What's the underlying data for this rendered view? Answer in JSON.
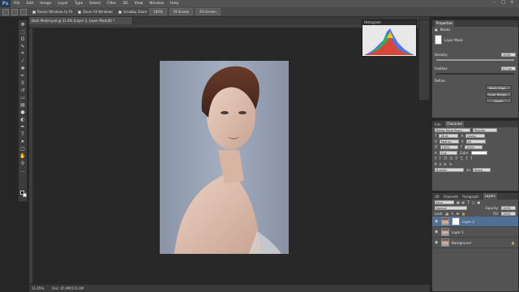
{
  "app": {
    "logo": "Ps"
  },
  "menu": [
    "File",
    "Edit",
    "Image",
    "Layer",
    "Type",
    "Select",
    "Filter",
    "3D",
    "View",
    "Window",
    "Help"
  ],
  "options": {
    "resize_windows": "Resize Windows to Fit",
    "zoom_all": "Zoom All Windows",
    "scrubby_zoom": "Scrubby Zoom",
    "btn_100": "100%",
    "btn_fit": "Fit Screen",
    "btn_fill": "Fill Screen"
  },
  "document": {
    "tab_title": "Dark Model.psd @ 11.6% (Layer 2, Layer Mask/8) *",
    "zoom": "11.65%",
    "doc_size": "Doc: 65.9M/115.4M"
  },
  "histogram": {
    "title": "Histogram"
  },
  "properties": {
    "tab": "Properties",
    "masks_label": "Masks",
    "layer_mask_label": "Layer Mask",
    "density_label": "Density:",
    "density_value": "100%",
    "density_level": 1.0,
    "feather_label": "Feather:",
    "feather_value": "0.0 px",
    "feather_level": 0.0,
    "refine_label": "Refine:",
    "btn_mask_edge": "Mask Edge...",
    "btn_color_range": "Color Range...",
    "btn_invert": "Invert"
  },
  "character": {
    "tabs": [
      "Info",
      "Character"
    ],
    "font": "Bebas Neue Regu...",
    "style": "Regular",
    "size": "28 pt",
    "leading": "(Auto)",
    "kerning": "Metrics",
    "tracking": "40",
    "vscale": "100%",
    "hscale": "100%",
    "baseline": "0 pt",
    "color_label": "Color:",
    "lang": "Russian",
    "aa": "Sharp"
  },
  "layers": {
    "tabs": [
      "3D",
      "Channels",
      "Paragraph",
      "Layers"
    ],
    "kind_filter": "Kind",
    "blend_mode": "Normal",
    "opacity_label": "Opacity:",
    "opacity_value": "100%",
    "lock_label": "Lock:",
    "fill_label": "Fill:",
    "fill_value": "100%",
    "items": [
      {
        "name": "Layer 2",
        "thumb": "white"
      },
      {
        "name": "Layer 1",
        "thumb": "face"
      },
      {
        "name": "Background",
        "thumb": "face"
      }
    ]
  }
}
